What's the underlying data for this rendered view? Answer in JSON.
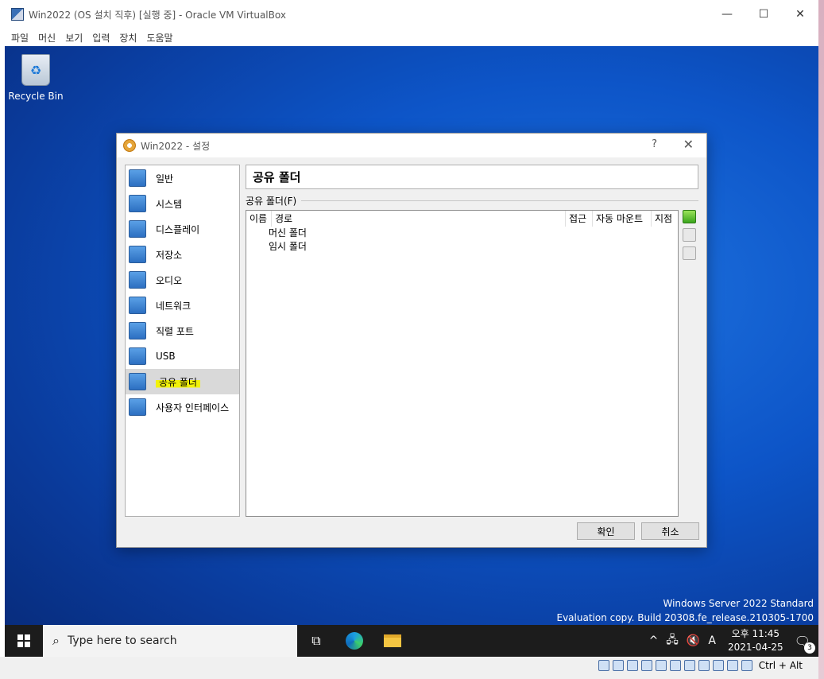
{
  "window": {
    "title": "Win2022 (OS 설치 직후) [실행 중] - Oracle VM VirtualBox",
    "minimize": "—",
    "maximize": "☐",
    "close": "✕"
  },
  "menubar": [
    "파일",
    "머신",
    "보기",
    "입력",
    "장치",
    "도움말"
  ],
  "desktop": {
    "recycle_bin": "Recycle Bin",
    "watermark_line1": "Windows Server 2022 Standard",
    "watermark_line2": "Evaluation copy. Build 20308.fe_release.210305-1700"
  },
  "dialog": {
    "title": "Win2022 - 설정",
    "help": "?",
    "close": "✕",
    "nav": [
      {
        "label": "일반"
      },
      {
        "label": "시스템"
      },
      {
        "label": "디스플레이"
      },
      {
        "label": "저장소"
      },
      {
        "label": "오디오"
      },
      {
        "label": "네트워크"
      },
      {
        "label": "직렬 포트"
      },
      {
        "label": "USB"
      },
      {
        "label": "공유 폴더"
      },
      {
        "label": "사용자 인터페이스"
      }
    ],
    "page_title": "공유 폴더",
    "group_label": "공유 폴더(F)",
    "columns": [
      "이름",
      "경로",
      "접근",
      "자동 마운트",
      "지점"
    ],
    "rows": [
      "머신 폴더",
      "임시 폴더"
    ],
    "ok": "확인",
    "cancel": "취소"
  },
  "taskbar": {
    "search_placeholder": "Type here to search",
    "time": "오후 11:45",
    "date": "2021-04-25",
    "ime": "A",
    "notifications": "3"
  },
  "statusbar": {
    "host_key": "Ctrl + Alt"
  }
}
